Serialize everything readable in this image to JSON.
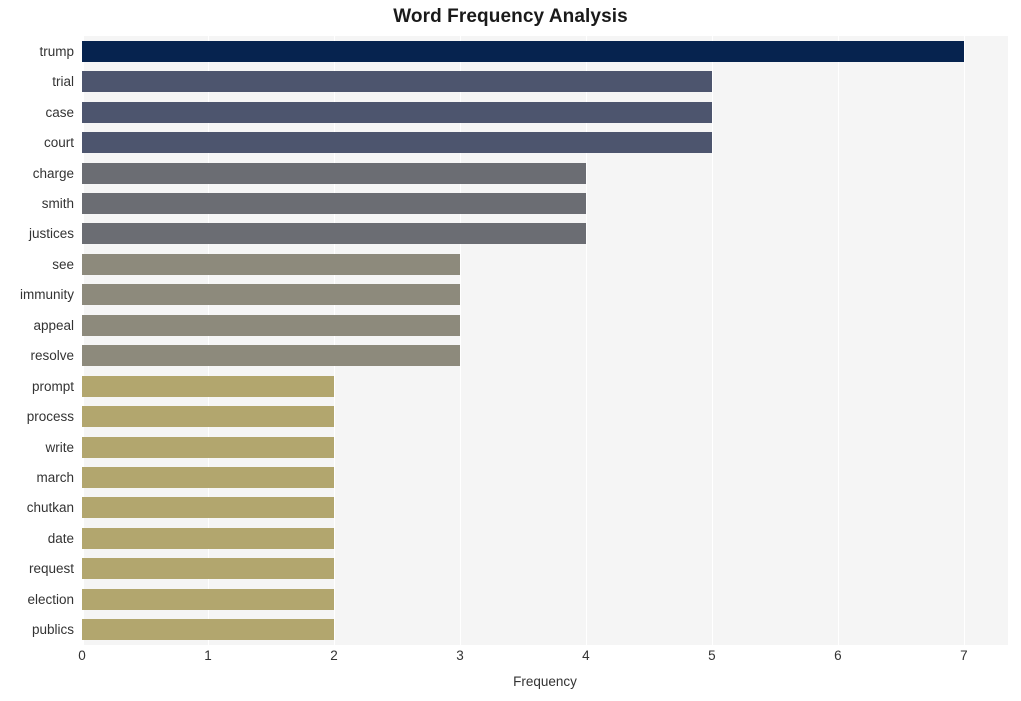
{
  "chart_data": {
    "type": "bar",
    "orientation": "horizontal",
    "title": "Word Frequency Analysis",
    "xlabel": "Frequency",
    "ylabel": "",
    "xlim": [
      0,
      7.35
    ],
    "xticks": [
      0,
      1,
      2,
      3,
      4,
      5,
      6,
      7
    ],
    "xtick_labels": [
      "0",
      "1",
      "2",
      "3",
      "4",
      "5",
      "6",
      "7"
    ],
    "grid": "vertical-white-on-gray",
    "legend": "none",
    "categories": [
      "trump",
      "trial",
      "case",
      "court",
      "charge",
      "smith",
      "justices",
      "see",
      "immunity",
      "appeal",
      "resolve",
      "prompt",
      "process",
      "write",
      "march",
      "chutkan",
      "date",
      "request",
      "election",
      "publics"
    ],
    "values": [
      7,
      5,
      5,
      5,
      4,
      4,
      4,
      3,
      3,
      3,
      3,
      2,
      2,
      2,
      2,
      2,
      2,
      2,
      2,
      2
    ],
    "bar_colors": [
      "#06234f",
      "#4d556e",
      "#4d556e",
      "#4d556e",
      "#6b6d73",
      "#6b6d73",
      "#6b6d73",
      "#8d8a7c",
      "#8d8a7c",
      "#8d8a7c",
      "#8d8a7c",
      "#b2a66e",
      "#b2a66e",
      "#b2a66e",
      "#b2a66e",
      "#b2a66e",
      "#b2a66e",
      "#b2a66e",
      "#b2a66e",
      "#b2a66e"
    ],
    "plot_background": "#f5f5f5",
    "figure_background": "#ffffff",
    "gridline_color": "#ffffff"
  }
}
